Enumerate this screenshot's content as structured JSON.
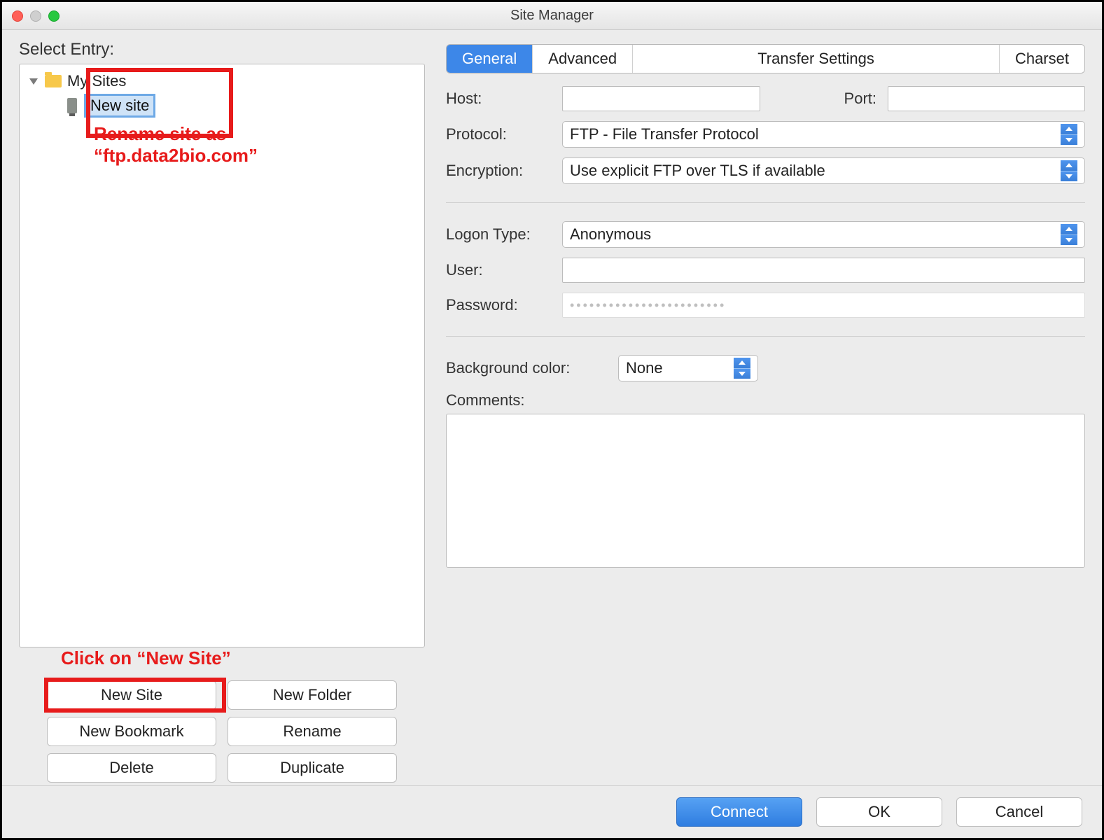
{
  "window": {
    "title": "Site Manager"
  },
  "left": {
    "select_label": "Select Entry:",
    "folder": "My Sites",
    "site_name": "New site",
    "annotation1_line1": "Rename site as",
    "annotation1_line2": "“ftp.data2bio.com”",
    "annotation2": "Click on “New Site”",
    "buttons": {
      "new_site": "New Site",
      "new_folder": "New Folder",
      "new_bookmark": "New Bookmark",
      "rename": "Rename",
      "delete": "Delete",
      "duplicate": "Duplicate"
    }
  },
  "tabs": {
    "general": "General",
    "advanced": "Advanced",
    "transfer": "Transfer Settings",
    "charset": "Charset"
  },
  "form": {
    "host_label": "Host:",
    "host_value": "",
    "port_label": "Port:",
    "port_value": "",
    "protocol_label": "Protocol:",
    "protocol_value": "FTP - File Transfer Protocol",
    "encryption_label": "Encryption:",
    "encryption_value": "Use explicit FTP over TLS if available",
    "logon_label": "Logon Type:",
    "logon_value": "Anonymous",
    "user_label": "User:",
    "user_value": "",
    "password_label": "Password:",
    "password_mask": "••••••••••••••••••••••••",
    "bgcolor_label": "Background color:",
    "bgcolor_value": "None",
    "comments_label": "Comments:",
    "comments_value": ""
  },
  "footer": {
    "connect": "Connect",
    "ok": "OK",
    "cancel": "Cancel"
  }
}
